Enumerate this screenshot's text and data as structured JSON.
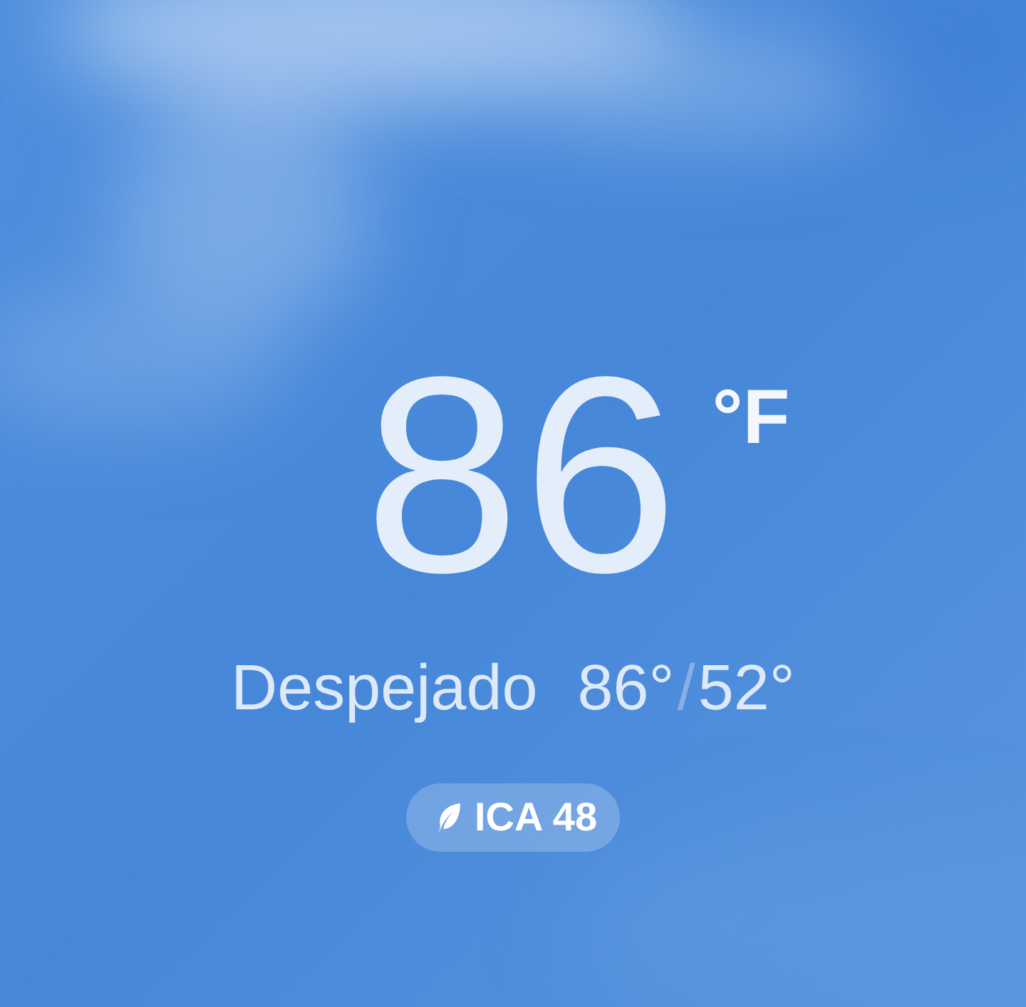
{
  "current": {
    "temperature": "86",
    "unit": "°F"
  },
  "summary": {
    "condition": "Despejado",
    "high": "86°",
    "separator": "/",
    "low": "52°"
  },
  "air_quality": {
    "label": "ICA 48"
  }
}
